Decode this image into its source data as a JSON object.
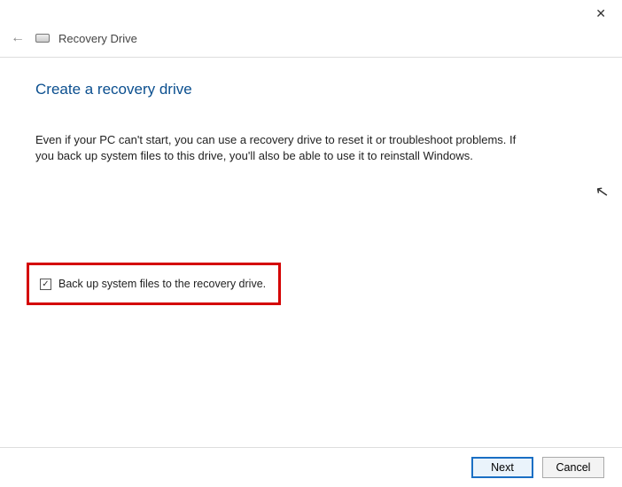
{
  "window": {
    "title": "Recovery Drive"
  },
  "page": {
    "heading": "Create a recovery drive",
    "description": "Even if your PC can't start, you can use a recovery drive to reset it or troubleshoot problems. If you back up system files to this drive, you'll also be able to use it to reinstall Windows."
  },
  "checkbox": {
    "label": "Back up system files to the recovery drive.",
    "checked": true
  },
  "buttons": {
    "next": "Next",
    "cancel": "Cancel"
  }
}
